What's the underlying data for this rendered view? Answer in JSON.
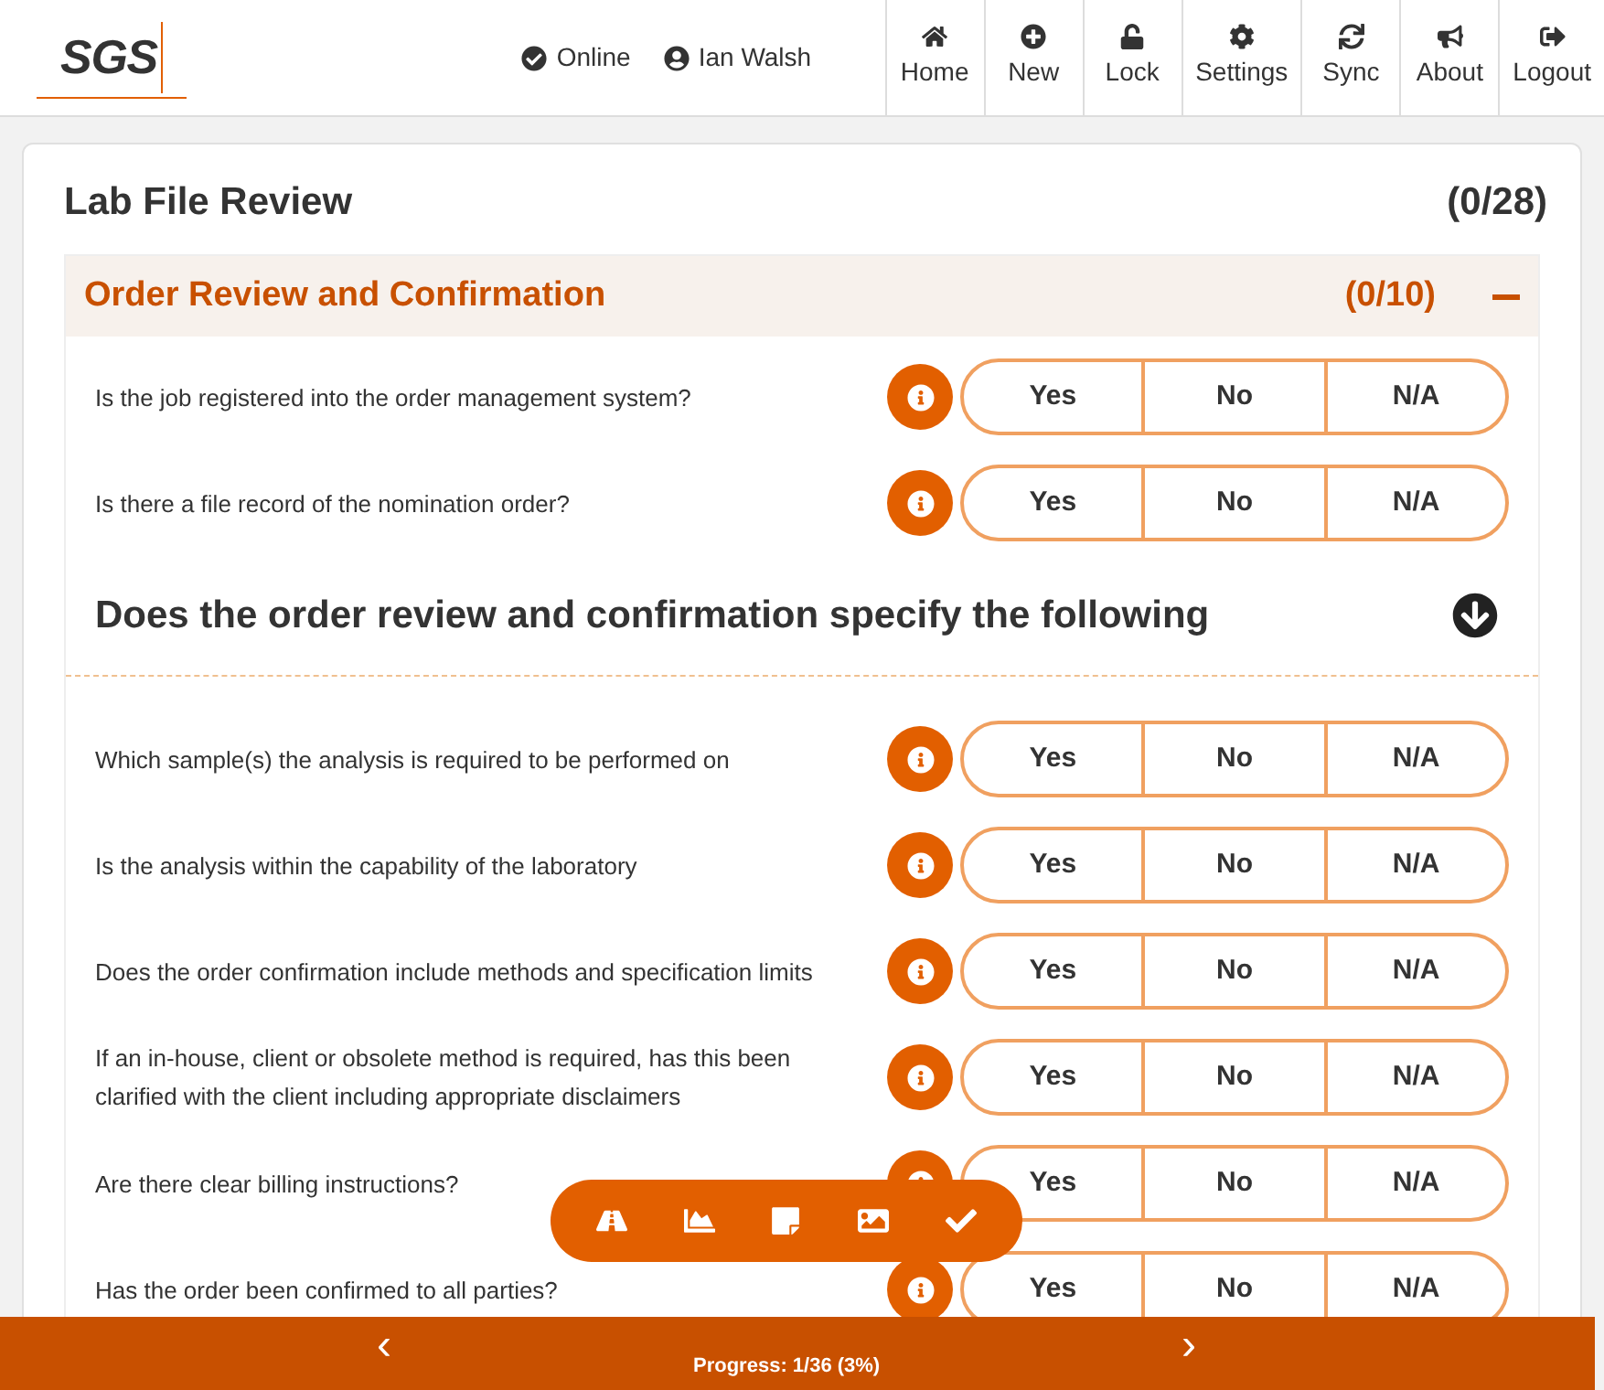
{
  "header": {
    "logo": "SGS",
    "status": "Online",
    "user": "Ian Walsh",
    "nav": [
      {
        "label": "Home"
      },
      {
        "label": "New"
      },
      {
        "label": "Lock"
      },
      {
        "label": "Settings"
      },
      {
        "label": "Sync"
      },
      {
        "label": "About"
      },
      {
        "label": "Logout"
      }
    ]
  },
  "review": {
    "title": "Lab File Review",
    "count": "(0/28)",
    "section": {
      "title": "Order Review and Confirmation",
      "count": "(0/10)",
      "expanded": true,
      "items": [
        {
          "kind": "question",
          "text": "Is the job registered into the order management system?",
          "options": [
            {
              "label": "Yes",
              "selected": false
            },
            {
              "label": "No",
              "selected": false
            },
            {
              "label": "N/A",
              "selected": false
            }
          ]
        },
        {
          "kind": "question",
          "text": "Is there a file record of the nomination order?",
          "options": [
            {
              "label": "Yes",
              "selected": false
            },
            {
              "label": "No",
              "selected": false
            },
            {
              "label": "N/A",
              "selected": false
            }
          ]
        },
        {
          "kind": "subheading",
          "text": "Does the order review and confirmation specify the following"
        },
        {
          "kind": "question",
          "text": "Which sample(s) the analysis is required to be performed on",
          "options": [
            {
              "label": "Yes",
              "selected": false
            },
            {
              "label": "No",
              "selected": false
            },
            {
              "label": "N/A",
              "selected": false
            }
          ]
        },
        {
          "kind": "question",
          "text": "Is the analysis within the capability of the laboratory",
          "options": [
            {
              "label": "Yes",
              "selected": false
            },
            {
              "label": "No",
              "selected": false
            },
            {
              "label": "N/A",
              "selected": false
            }
          ]
        },
        {
          "kind": "question",
          "text": "Does the order confirmation include methods and specification limits",
          "options": [
            {
              "label": "Yes",
              "selected": false
            },
            {
              "label": "No",
              "selected": false
            },
            {
              "label": "N/A",
              "selected": false
            }
          ]
        },
        {
          "kind": "question",
          "text": "If an in-house, client or obsolete method is required, has this been clarified with the client including appropriate disclaimers",
          "options": [
            {
              "label": "Yes",
              "selected": false
            },
            {
              "label": "No",
              "selected": false
            },
            {
              "label": "N/A",
              "selected": false
            }
          ]
        },
        {
          "kind": "question",
          "text": "Are there clear billing instructions?",
          "options": [
            {
              "label": "Yes",
              "selected": false
            },
            {
              "label": "No",
              "selected": false
            },
            {
              "label": "N/A",
              "selected": false
            }
          ]
        },
        {
          "kind": "question",
          "text": "Has the order been confirmed to all parties?",
          "options": [
            {
              "label": "Yes",
              "selected": false
            },
            {
              "label": "No",
              "selected": false
            },
            {
              "label": "N/A",
              "selected": false
            }
          ]
        }
      ]
    }
  },
  "footer": {
    "progress": "Progress: 1/36 (3%)",
    "prev": "‹",
    "next": "›"
  }
}
